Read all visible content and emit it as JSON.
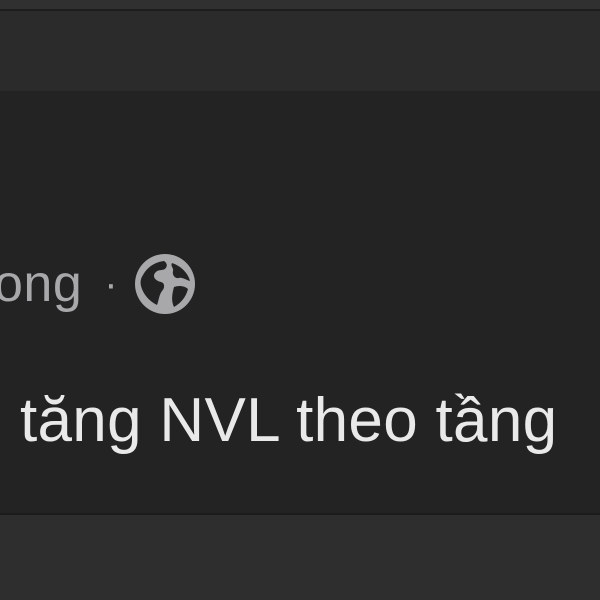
{
  "post": {
    "author_fragment": "ong",
    "separator": "·",
    "audience_icon": "globe-icon",
    "text": "tăng NVL theo tầng"
  },
  "colors": {
    "card_background": "#232324",
    "chrome_background": "#2b2b2c",
    "meta_text": "#a8a8aa",
    "body_text": "#e9e9ea"
  }
}
